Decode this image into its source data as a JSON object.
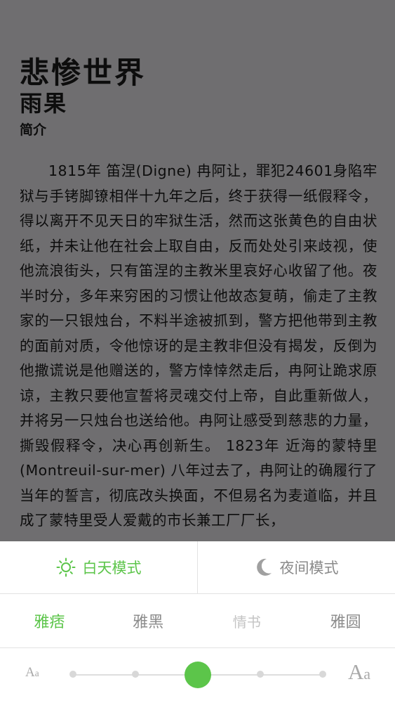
{
  "book": {
    "title": "悲惨世界",
    "author": "雨果",
    "intro_label": "简介",
    "intro_text": "1815年 笛涅(Digne) 冉阿让，罪犯24601身陷牢狱与手铐脚镣相伴十九年之后，终于获得一纸假释令，得以离开不见天日的牢狱生活，然而这张黄色的自由状纸，并未让他在社会上取自由，反而处处引来歧视，使他流浪街头，只有笛涅的主教米里哀好心收留了他。夜半时分，多年来穷困的习惯让他故态复萌，偷走了主教家的一只银烛台，不料半途被抓到，警方把他带到主教的面前对质，令他惊讶的是主教非但没有揭发，反倒为他撒谎说是他赠送的，警方悻悻然走后，冉阿让跪求原谅，主教只要他宣誓将灵魂交付上帝，自此重新做人，并将另一只烛台也送给他。冉阿让感受到慈悲的力量，撕毁假释令，决心再创新生。 1823年 近海的蒙特里(Montreuil-sur-mer) 八年过去了，冉阿让的确履行了当年的誓言，彻底改头换面，不但易名为麦道临，并且成了蒙特里受人爱戴的市长兼工厂厂长，"
  },
  "modes": {
    "day_label": "白天模式",
    "night_label": "夜间模式",
    "day_icon": "sun-icon",
    "night_icon": "moon-icon"
  },
  "fonts": [
    {
      "label": "雅痞",
      "active": true
    },
    {
      "label": "雅黑",
      "active": false
    },
    {
      "label": "情书",
      "active": false
    },
    {
      "label": "雅圆",
      "active": false
    }
  ],
  "font_size": {
    "small_label": "A",
    "small_sub": "a",
    "large_label": "A",
    "large_sub": "a",
    "steps": 5,
    "selected_step": 2
  },
  "colors": {
    "accent": "#5cc54a",
    "reader_bg": "#6f6e70",
    "text": "#0d0d0d"
  }
}
